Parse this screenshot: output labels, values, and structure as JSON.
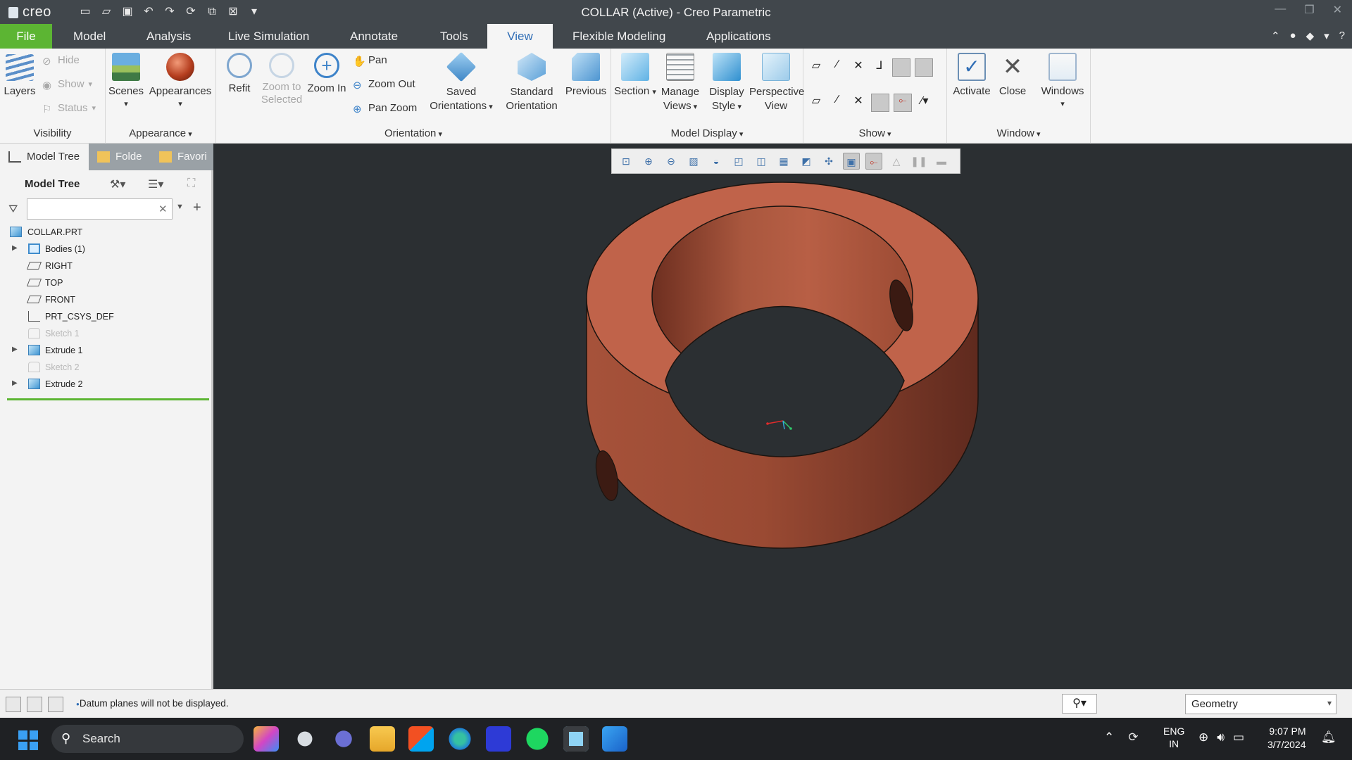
{
  "app": {
    "logo_text": "creo",
    "window_title": "COLLAR (Active) - Creo Parametric",
    "window_controls": [
      "—",
      "❐",
      "✕"
    ]
  },
  "tabs": [
    {
      "label": "File"
    },
    {
      "label": "Model"
    },
    {
      "label": "Analysis"
    },
    {
      "label": "Live Simulation"
    },
    {
      "label": "Annotate"
    },
    {
      "label": "Tools"
    },
    {
      "label": "View"
    },
    {
      "label": "Flexible Modeling"
    },
    {
      "label": "Applications"
    }
  ],
  "ribbon": {
    "visibility": {
      "label": "Visibility",
      "layers": "Layers",
      "hide": "Hide",
      "show": "Show",
      "status": "Status"
    },
    "appearance": {
      "label": "Appearance",
      "scenes": "Scenes",
      "appearances": "Appearances"
    },
    "orientation": {
      "label": "Orientation",
      "refit": "Refit",
      "zoom_to_selected": "Zoom to Selected",
      "zoom_in": "Zoom In",
      "pan": "Pan",
      "zoom_out": "Zoom Out",
      "pan_zoom": "Pan Zoom",
      "saved_orientations": "Saved Orientations",
      "standard_orientation": "Standard Orientation",
      "previous": "Previous"
    },
    "model_display": {
      "label": "Model Display",
      "section": "Section",
      "manage_views": "Manage Views",
      "display_style": "Display Style",
      "perspective_view": "Perspective View"
    },
    "show": {
      "label": "Show"
    },
    "window": {
      "label": "Window",
      "activate": "Activate",
      "close": "Close",
      "windows": "Windows"
    }
  },
  "panel": {
    "tabs": [
      "Model Tree",
      "Folde",
      "Favori"
    ],
    "tree_header": "Model Tree",
    "filter_value": "",
    "tree": [
      {
        "label": "COLLAR.PRT",
        "icon": "part-icon",
        "expandable": false,
        "dim": false
      },
      {
        "label": "Bodies (1)",
        "icon": "bodies-icon",
        "expandable": true,
        "dim": false
      },
      {
        "label": "RIGHT",
        "icon": "datum-plane-icon",
        "expandable": false,
        "dim": false
      },
      {
        "label": "TOP",
        "icon": "datum-plane-icon",
        "expandable": false,
        "dim": false
      },
      {
        "label": "FRONT",
        "icon": "datum-plane-icon",
        "expandable": false,
        "dim": false
      },
      {
        "label": "PRT_CSYS_DEF",
        "icon": "csys-icon",
        "expandable": false,
        "dim": false
      },
      {
        "label": "Sketch 1",
        "icon": "sketch-icon",
        "expandable": false,
        "dim": true
      },
      {
        "label": "Extrude 1",
        "icon": "extrude-icon",
        "expandable": true,
        "dim": false
      },
      {
        "label": "Sketch 2",
        "icon": "sketch-icon",
        "expandable": false,
        "dim": true
      },
      {
        "label": "Extrude 2",
        "icon": "extrude-icon",
        "expandable": true,
        "dim": false
      }
    ]
  },
  "status": {
    "message": "Datum planes will not be displayed.",
    "filter_select": "Geometry"
  },
  "taskbar": {
    "search_placeholder": "Search",
    "lang_line1": "ENG",
    "lang_line2": "IN",
    "time": "9:07 PM",
    "date": "3/7/2024"
  },
  "colors": {
    "file_tab": "#5cb533",
    "active_tab_text": "#2f6db5",
    "model_color": "#c0634a",
    "viewport_bg": "#2b2f32"
  }
}
